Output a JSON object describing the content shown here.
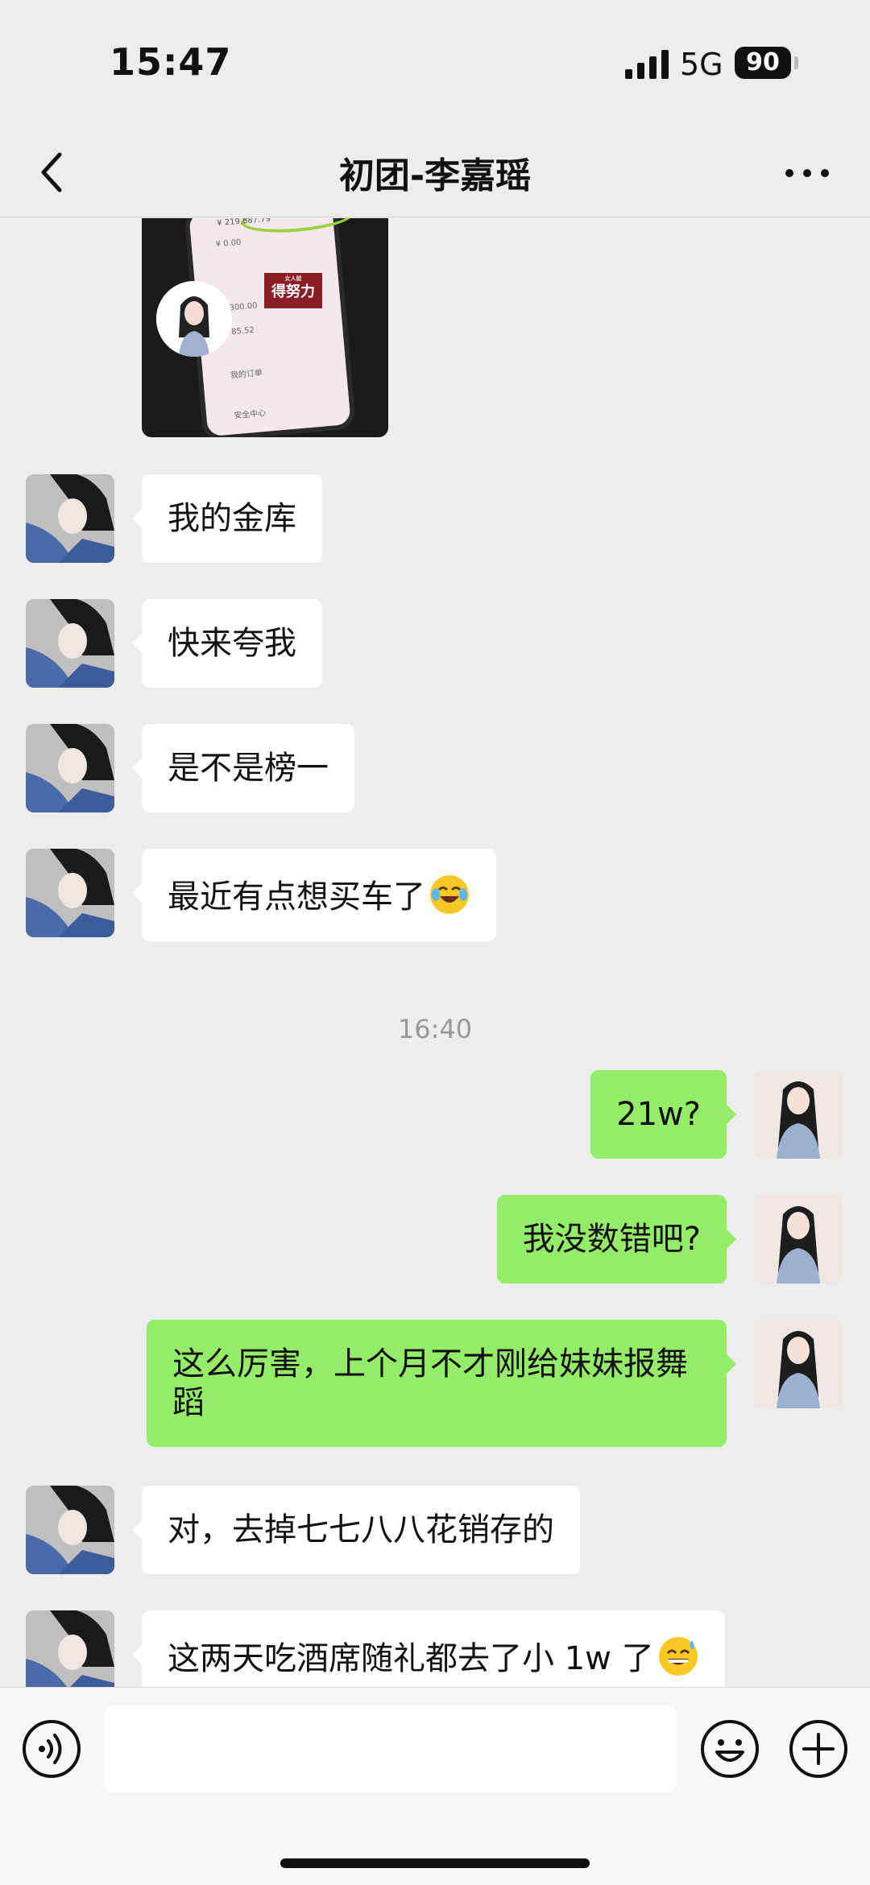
{
  "status_bar": {
    "time": "15:47",
    "network": "5G",
    "battery": "90"
  },
  "header": {
    "title": "初团-李嘉瑶",
    "back_icon": "chevron-left-icon",
    "more_icon": "more-dots-icon"
  },
  "image_message": {
    "sender": "contact",
    "balance_text": "¥ 219,887.79",
    "rows": [
      "¥ 0.00",
      "300.00",
      "85.52",
      "我的订单",
      "安全中心"
    ],
    "stamp_sub": "女人就",
    "stamp_text": "得努力"
  },
  "messages": [
    {
      "side": "left",
      "text": "我的金库"
    },
    {
      "side": "left",
      "text": "快来夸我"
    },
    {
      "side": "left",
      "text": "是不是榜一"
    },
    {
      "side": "left",
      "text": "最近有点想买车了",
      "emoji": "crying-laughing-emoji"
    },
    {
      "type": "time",
      "text": "16:40"
    },
    {
      "side": "right",
      "text": "21w?"
    },
    {
      "side": "right",
      "text": "我没数错吧?"
    },
    {
      "side": "right",
      "text": "这么厉害，上个月不才刚给妹妹报舞蹈"
    },
    {
      "side": "left",
      "text": "对，去掉七七八八花销存的"
    },
    {
      "side": "left",
      "text": "这两天吃酒席随礼都去了小 1w 了",
      "emoji": "sweat-smile-emoji"
    }
  ],
  "input_bar": {
    "voice_icon": "voice-icon",
    "input_value": "",
    "emoji_icon": "emoji-icon",
    "plus_icon": "plus-icon"
  },
  "colors": {
    "background": "#ededed",
    "outgoing_bubble": "#95ec69",
    "incoming_bubble": "#ffffff",
    "timestamp": "#999999"
  }
}
